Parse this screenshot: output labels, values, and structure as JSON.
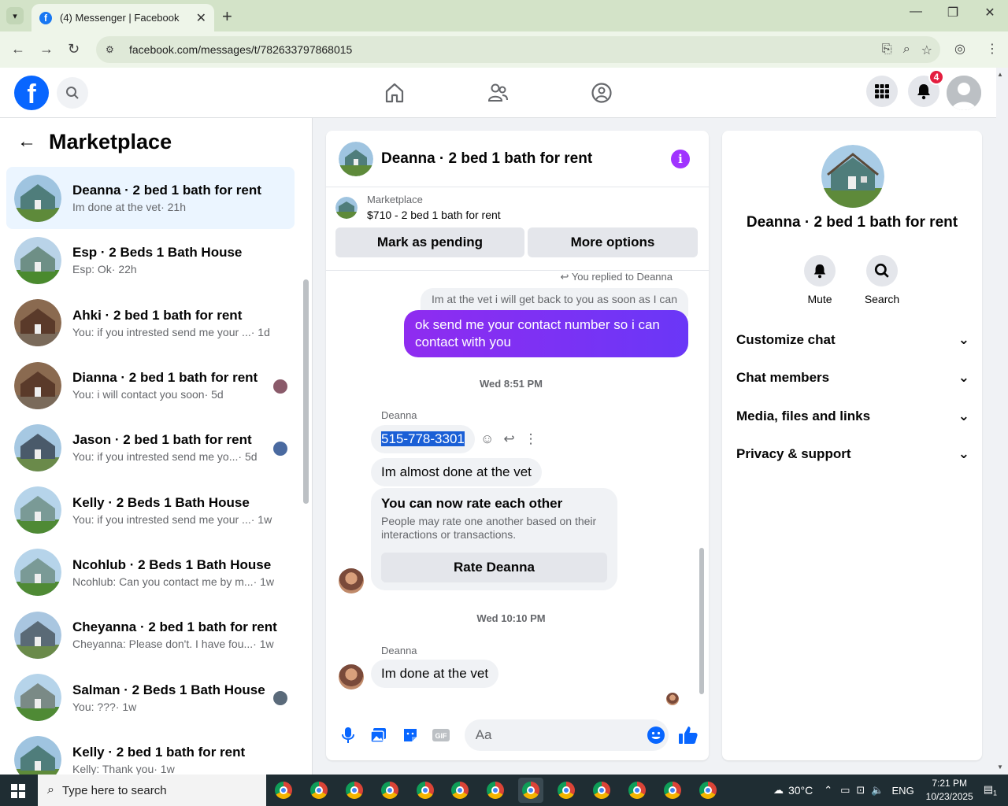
{
  "browser": {
    "tab_title": "(4) Messenger | Facebook",
    "url": "facebook.com/messages/t/782633797868015"
  },
  "header": {
    "notification_count": "4"
  },
  "left_panel": {
    "title": "Marketplace",
    "conversations": [
      {
        "name": "Deanna · 2 bed 1 bath for rent",
        "preview": "Im done at the vet",
        "time": "· 21h",
        "active": true
      },
      {
        "name": "Esp · 2 Beds 1 Bath House",
        "preview": "Esp: Ok",
        "time": "· 22h"
      },
      {
        "name": "Ahki · 2 bed 1 bath for rent",
        "preview": "You: if you intrested send me your ...",
        "time": " · 1d"
      },
      {
        "name": "Dianna · 2 bed 1 bath for rent",
        "preview": "You: i will contact you soon",
        "time": " · 5d"
      },
      {
        "name": "Jason · 2 bed 1 bath for rent",
        "preview": "You: if you intrested send me yo...",
        "time": " · 5d"
      },
      {
        "name": "Kelly · 2 Beds 1 Bath House",
        "preview": "You: if you intrested send me your ...",
        "time": " · 1w"
      },
      {
        "name": "Ncohlub · 2 Beds 1 Bath House",
        "preview": "Ncohlub: Can you contact me by m...",
        "time": " · 1w"
      },
      {
        "name": "Cheyanna · 2 bed 1 bath for rent",
        "preview": "Cheyanna: Please don't. I have fou...",
        "time": " · 1w"
      },
      {
        "name": "Salman · 2 Beds 1 Bath House",
        "preview": "You: ???",
        "time": " · 1w"
      },
      {
        "name": "Kelly · 2 bed 1 bath for rent",
        "preview": "Kelly: Thank you",
        "time": " · 1w"
      }
    ]
  },
  "chat": {
    "title": "Deanna · 2 bed 1 bath for rent",
    "listing_category": "Marketplace",
    "listing_price": "$710 - 2 bed 1 bath for rent",
    "mark_pending": "Mark as pending",
    "more_options": "More options",
    "replied_note": "You replied to Deanna",
    "quoted": "Im at the vet i will get back to you as soon as I can",
    "outgoing": "ok  send me your contact number so i can contact with you",
    "ts1": "Wed 8:51 PM",
    "sender": "Deanna",
    "phone": "515-778-3301",
    "msg2": "Im almost done at the vet",
    "rate_title": "You can now rate each other",
    "rate_desc": "People may rate one another based on their interactions or transactions.",
    "rate_button": "Rate Deanna",
    "ts2": "Wed 10:10 PM",
    "msg3": "Im done at the vet",
    "composer_placeholder": "Aa"
  },
  "right_panel": {
    "title": "Deanna · 2 bed 1 bath for rent",
    "mute": "Mute",
    "search": "Search",
    "sections": [
      "Customize chat",
      "Chat members",
      "Media, files and links",
      "Privacy & support"
    ]
  },
  "taskbar": {
    "search_placeholder": "Type here to search",
    "temperature": "30°C",
    "language": "ENG",
    "time": "7:21 PM",
    "date": "10/23/2025",
    "notif": "1"
  }
}
